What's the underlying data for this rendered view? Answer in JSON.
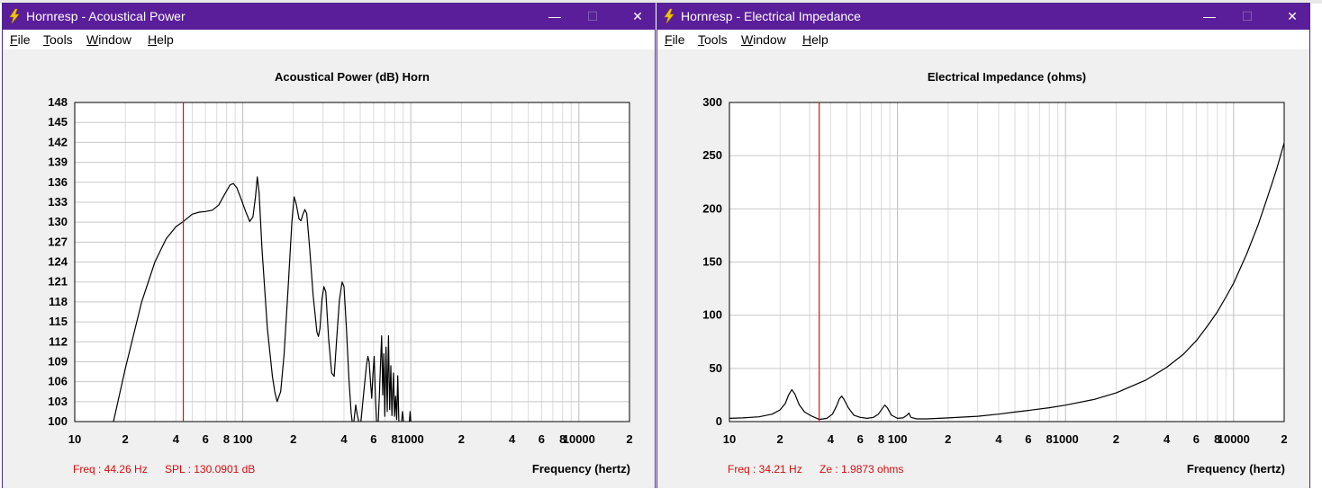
{
  "windows": [
    {
      "title": "Hornresp - Acoustical Power",
      "menu": [
        "File",
        "Tools",
        "Window",
        "Help"
      ],
      "controls": {
        "minimize": "—",
        "maximize": "☐",
        "close": "✕"
      },
      "chart_data": {
        "type": "line",
        "title": "Acoustical Power (dB)   Horn",
        "xlabel": "Frequency (hertz)",
        "x_scale": "log",
        "xlim": [
          10,
          20000
        ],
        "ylim": [
          100,
          148
        ],
        "yticks": [
          "148",
          "145",
          "142",
          "139",
          "136",
          "133",
          "130",
          "127",
          "124",
          "121",
          "118",
          "115",
          "112",
          "109",
          "106",
          "103",
          "100"
        ],
        "xtick_labels": [
          {
            "f": 10,
            "t": "10"
          },
          {
            "f": 20,
            "t": "2"
          },
          {
            "f": 40,
            "t": "4"
          },
          {
            "f": 60,
            "t": "6"
          },
          {
            "f": 80,
            "t": "8"
          },
          {
            "f": 100,
            "t": "100"
          },
          {
            "f": 200,
            "t": "2"
          },
          {
            "f": 400,
            "t": "4"
          },
          {
            "f": 600,
            "t": "6"
          },
          {
            "f": 800,
            "t": "8"
          },
          {
            "f": 1000,
            "t": "1000"
          },
          {
            "f": 2000,
            "t": "2"
          },
          {
            "f": 4000,
            "t": "4"
          },
          {
            "f": 6000,
            "t": "6"
          },
          {
            "f": 8000,
            "t": "8"
          },
          {
            "f": 10000,
            "t": "10000"
          },
          {
            "f": 20000,
            "t": "2"
          }
        ],
        "cursor_x": 44.26,
        "series": [
          {
            "values": [
              [
                17,
                100
              ],
              [
                20,
                108
              ],
              [
                25,
                118
              ],
              [
                30,
                124
              ],
              [
                35,
                127.5
              ],
              [
                40,
                129.3
              ],
              [
                44.26,
                130.1
              ],
              [
                50,
                131.2
              ],
              [
                55,
                131.5
              ],
              [
                60,
                131.6
              ],
              [
                66,
                131.8
              ],
              [
                72,
                132.6
              ],
              [
                78,
                134.2
              ],
              [
                84,
                135.6
              ],
              [
                88,
                135.8
              ],
              [
                92,
                135.2
              ],
              [
                98,
                133.4
              ],
              [
                104,
                131.6
              ],
              [
                110,
                130.1
              ],
              [
                115,
                130.8
              ],
              [
                119,
                133.8
              ],
              [
                122,
                136.8
              ],
              [
                125,
                134.5
              ],
              [
                130,
                126
              ],
              [
                140,
                114
              ],
              [
                150,
                106.8
              ],
              [
                155,
                104.5
              ],
              [
                160,
                103
              ],
              [
                168,
                104.5
              ],
              [
                176,
                110
              ],
              [
                186,
                120
              ],
              [
                196,
                130
              ],
              [
                202,
                133.8
              ],
              [
                208,
                132.7
              ],
              [
                216,
                130.5
              ],
              [
                222,
                130.2
              ],
              [
                228,
                131.2
              ],
              [
                234,
                131.9
              ],
              [
                240,
                131.3
              ],
              [
                250,
                126
              ],
              [
                262,
                119
              ],
              [
                276,
                113.5
              ],
              [
                282,
                112.8
              ],
              [
                288,
                114
              ],
              [
                296,
                118.5
              ],
              [
                304,
                120.3
              ],
              [
                312,
                119.5
              ],
              [
                324,
                112.5
              ],
              [
                338,
                107.3
              ],
              [
                350,
                106.8
              ],
              [
                362,
                112.5
              ],
              [
                376,
                118.3
              ],
              [
                390,
                121
              ],
              [
                400,
                120.3
              ],
              [
                414,
                114
              ],
              [
                428,
                106.5
              ],
              [
                442,
                101.2
              ],
              [
                448,
                100
              ]
            ]
          },
          {
            "values": [
              [
                458,
                100
              ],
              [
                470,
                102.5
              ],
              [
                480,
                101
              ],
              [
                490,
                100
              ]
            ]
          },
          {
            "values": [
              [
                505,
                100
              ],
              [
                525,
                104.5
              ],
              [
                545,
                108.5
              ],
              [
                555,
                109.8
              ],
              [
                565,
                109
              ],
              [
                575,
                106
              ],
              [
                585,
                103.5
              ],
              [
                595,
                107
              ],
              [
                605,
                109.8
              ],
              [
                615,
                104
              ],
              [
                625,
                100
              ]
            ]
          },
          {
            "values": [
              [
                640,
                100
              ],
              [
                650,
                104
              ],
              [
                660,
                108.5
              ],
              [
                670,
                112.9
              ],
              [
                680,
                104
              ],
              [
                690,
                110.2
              ],
              [
                700,
                100.8
              ],
              [
                712,
                111.2
              ],
              [
                724,
                101.5
              ],
              [
                736,
                112.9
              ],
              [
                748,
                101.8
              ],
              [
                760,
                108.4
              ],
              [
                772,
                100.9
              ],
              [
                788,
                107.3
              ],
              [
                800,
                100.8
              ],
              [
                812,
                103.8
              ],
              [
                824,
                100.3
              ],
              [
                836,
                106.9
              ],
              [
                848,
                100
              ]
            ]
          },
          {
            "values": [
              [
                880,
                100
              ],
              [
                893,
                101.5
              ],
              [
                905,
                100
              ]
            ]
          },
          {
            "values": [
              [
                980,
                100
              ],
              [
                990,
                101.5
              ],
              [
                1000,
                100
              ]
            ]
          }
        ]
      },
      "status": {
        "freq": "Freq : 44.26 Hz",
        "value": "SPL : 130.0901 dB",
        "axis": "Frequency (hertz)"
      }
    },
    {
      "title": "Hornresp - Electrical Impedance",
      "menu": [
        "File",
        "Tools",
        "Window",
        "Help"
      ],
      "controls": {
        "minimize": "—",
        "maximize": "☐",
        "close": "✕"
      },
      "chart_data": {
        "type": "line",
        "title": "Electrical Impedance (ohms)",
        "xlabel": "Frequency (hertz)",
        "x_scale": "log",
        "xlim": [
          10,
          20000
        ],
        "ylim": [
          0,
          300
        ],
        "yticks": [
          "300",
          "250",
          "200",
          "150",
          "100",
          "50",
          "0"
        ],
        "xtick_labels": [
          {
            "f": 10,
            "t": "10"
          },
          {
            "f": 20,
            "t": "2"
          },
          {
            "f": 40,
            "t": "4"
          },
          {
            "f": 60,
            "t": "6"
          },
          {
            "f": 80,
            "t": "8"
          },
          {
            "f": 100,
            "t": "100"
          },
          {
            "f": 200,
            "t": "2"
          },
          {
            "f": 400,
            "t": "4"
          },
          {
            "f": 600,
            "t": "6"
          },
          {
            "f": 800,
            "t": "8"
          },
          {
            "f": 1000,
            "t": "1000"
          },
          {
            "f": 2000,
            "t": "2"
          },
          {
            "f": 4000,
            "t": "4"
          },
          {
            "f": 6000,
            "t": "6"
          },
          {
            "f": 8000,
            "t": "8"
          },
          {
            "f": 10000,
            "t": "10000"
          },
          {
            "f": 20000,
            "t": "2"
          }
        ],
        "cursor_x": 34.21,
        "series": [
          {
            "values": [
              [
                10,
                3
              ],
              [
                12,
                3.5
              ],
              [
                15,
                4.5
              ],
              [
                18,
                7
              ],
              [
                20,
                11
              ],
              [
                21.5,
                17
              ],
              [
                22.5,
                25
              ],
              [
                23.5,
                30
              ],
              [
                24.5,
                26
              ],
              [
                26,
                16
              ],
              [
                28,
                9
              ],
              [
                31,
                5
              ],
              [
                34.21,
                2
              ],
              [
                38,
                3
              ],
              [
                41,
                7
              ],
              [
                43.5,
                15
              ],
              [
                45,
                21
              ],
              [
                46.5,
                24
              ],
              [
                48,
                21
              ],
              [
                51,
                13
              ],
              [
                55,
                6
              ],
              [
                60,
                4
              ],
              [
                66,
                3
              ],
              [
                72,
                4
              ],
              [
                77,
                7
              ],
              [
                81,
                12
              ],
              [
                84,
                15.5
              ],
              [
                87,
                13
              ],
              [
                92,
                6
              ],
              [
                100,
                3
              ],
              [
                108,
                3.5
              ],
              [
                114,
                6
              ],
              [
                117,
                8
              ],
              [
                120,
                4
              ],
              [
                130,
                2.5
              ],
              [
                150,
                2.5
              ],
              [
                200,
                3.5
              ],
              [
                300,
                5
              ],
              [
                400,
                7
              ],
              [
                500,
                9
              ],
              [
                600,
                10.5
              ],
              [
                800,
                13
              ],
              [
                1000,
                15.5
              ],
              [
                1500,
                21
              ],
              [
                2000,
                27
              ],
              [
                3000,
                39
              ],
              [
                4000,
                51
              ],
              [
                5000,
                63
              ],
              [
                6000,
                76
              ],
              [
                7000,
                90
              ],
              [
                8000,
                103
              ],
              [
                9000,
                117
              ],
              [
                10000,
                130
              ],
              [
                12000,
                158
              ],
              [
                14000,
                185
              ],
              [
                16000,
                212
              ],
              [
                18000,
                237
              ],
              [
                20000,
                262
              ]
            ]
          }
        ]
      },
      "status": {
        "freq": "Freq : 34.21 Hz",
        "value": "Ze : 1.9873 ohms",
        "axis": "Frequency (hertz)"
      }
    }
  ]
}
